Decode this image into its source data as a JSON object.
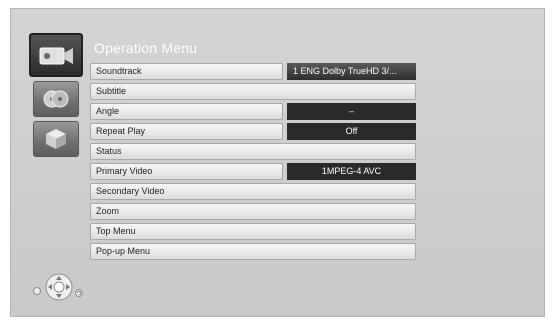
{
  "menu": {
    "title": "Operation Menu"
  },
  "side_icons": [
    {
      "icon": "video-camera-icon",
      "selected": true
    },
    {
      "icon": "disc-icon",
      "selected": false
    },
    {
      "icon": "box-icon",
      "selected": false
    }
  ],
  "rows": [
    {
      "label": "Soundtrack",
      "value": "1 ENG Dolby TrueHD  3/..."
    },
    {
      "label": "Subtitle"
    },
    {
      "label": "Angle",
      "value": "–"
    },
    {
      "label": "Repeat Play",
      "value": "Off"
    },
    {
      "label": "Status"
    },
    {
      "label": "Primary Video",
      "value": "1MPEG-4 AVC"
    },
    {
      "label": "Secondary Video"
    },
    {
      "label": "Zoom"
    },
    {
      "label": "Top Menu"
    },
    {
      "label": "Pop-up Menu"
    }
  ],
  "remote_hint": {
    "icons": [
      "circle-icon",
      "dpad-icon",
      "return-icon"
    ]
  }
}
